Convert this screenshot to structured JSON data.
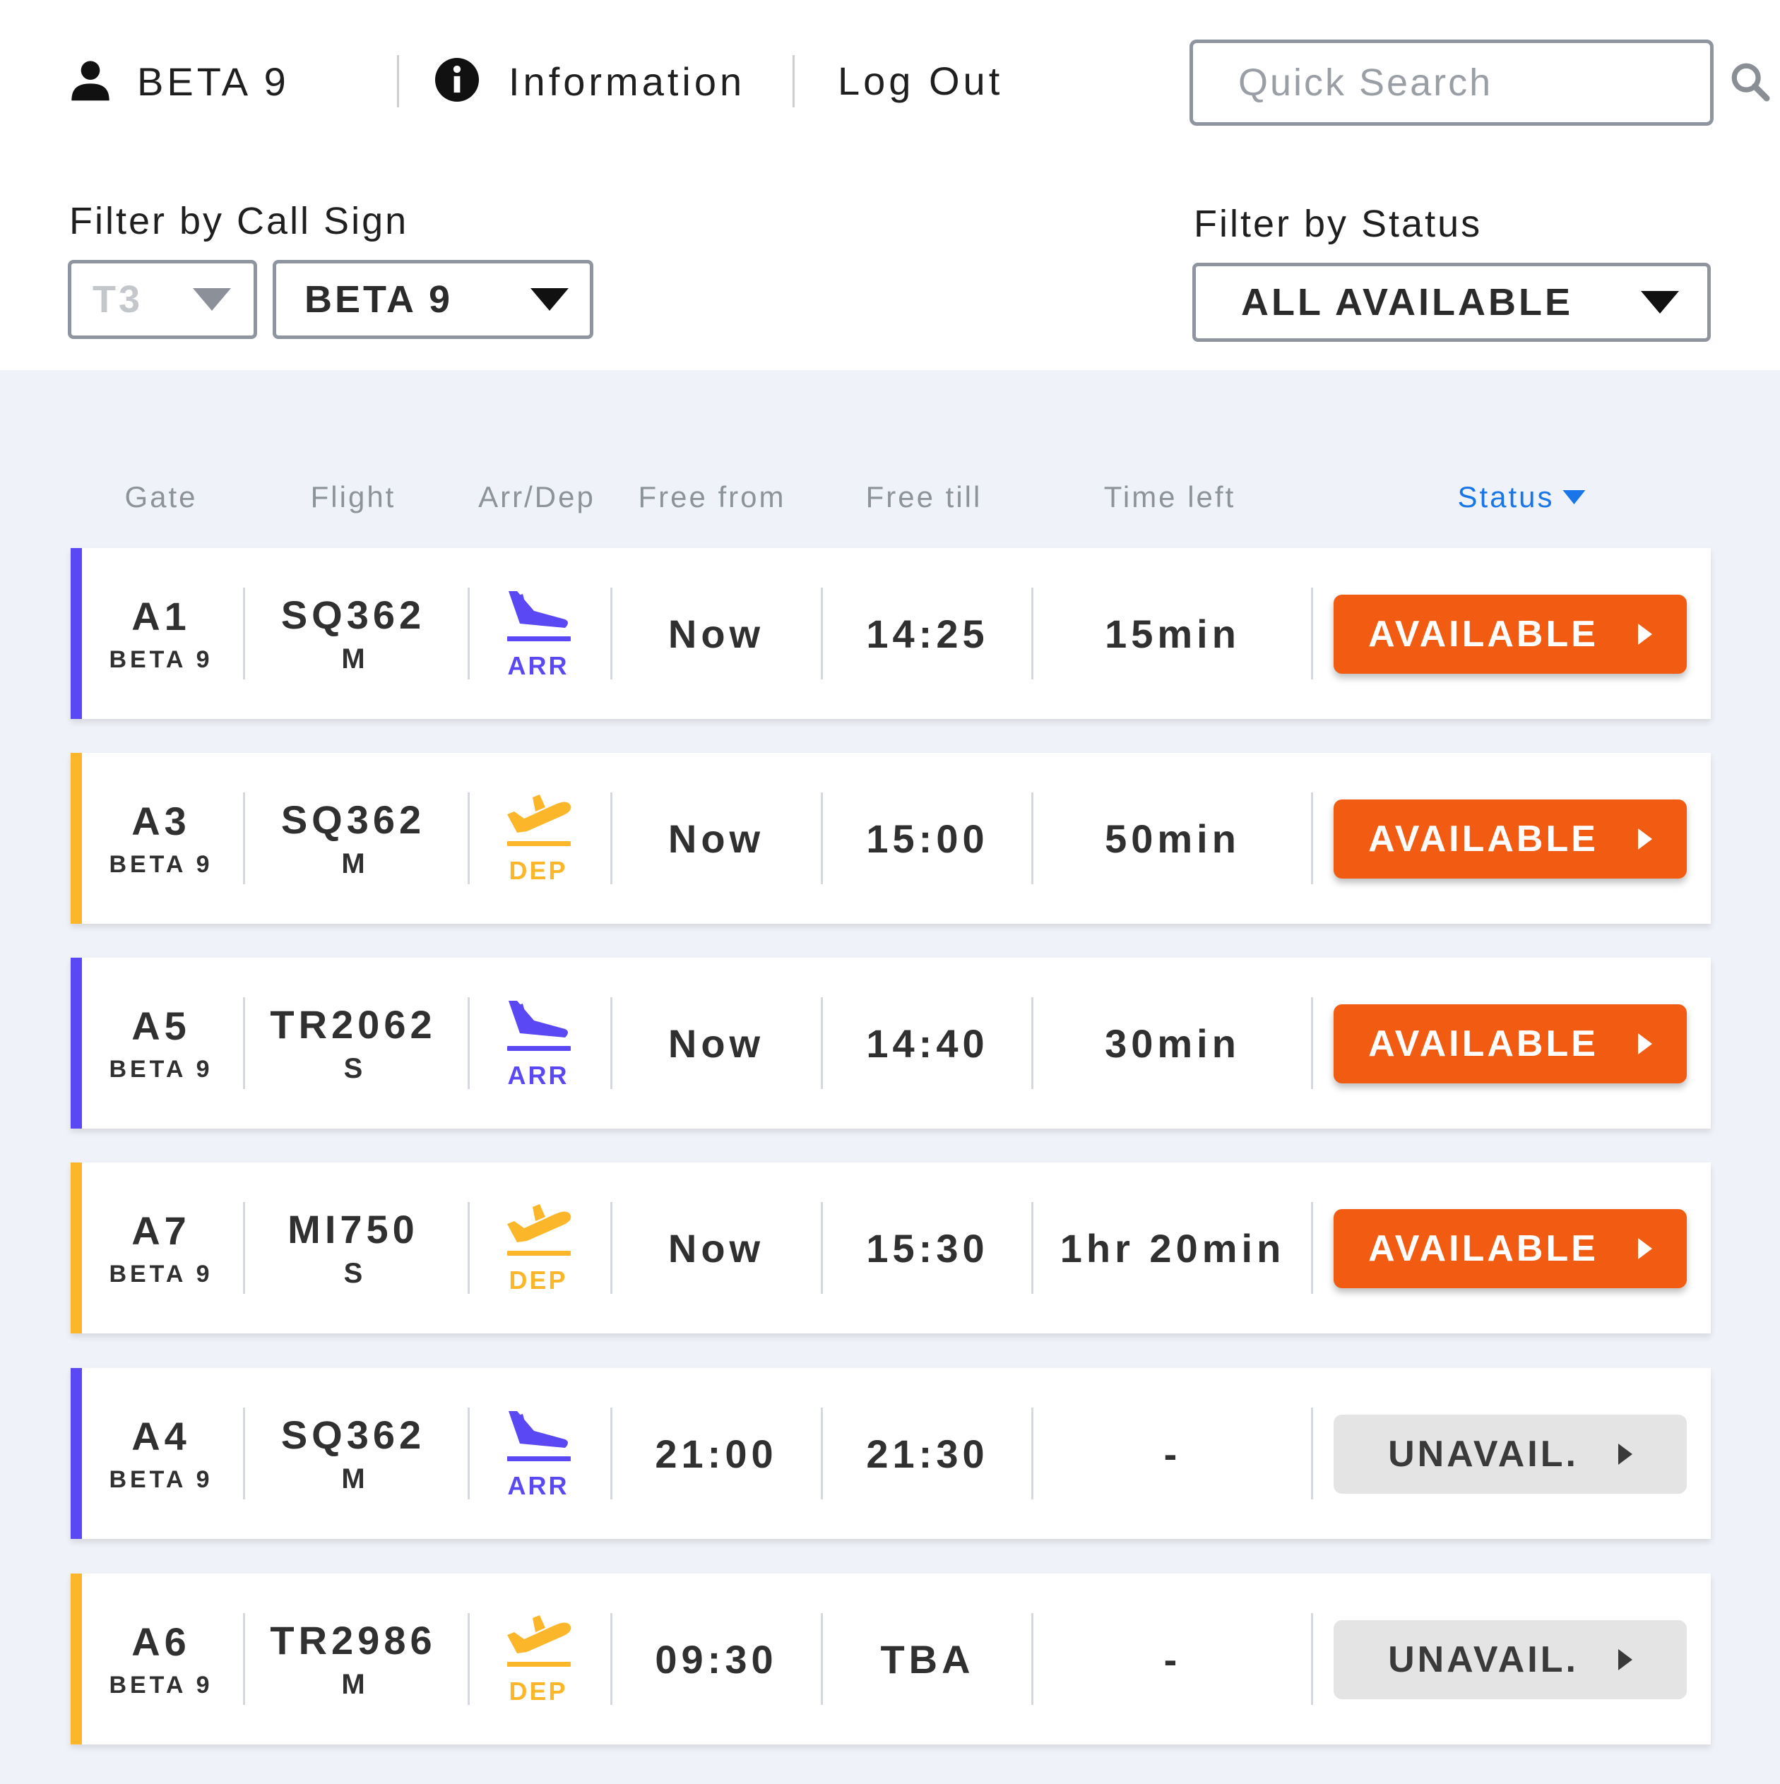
{
  "header": {
    "user_name": "BETA 9",
    "info_label": "Information",
    "logout_label": "Log Out",
    "search_placeholder": "Quick Search"
  },
  "filters": {
    "call_sign_label": "Filter by Call Sign",
    "terminal_value": "T3",
    "call_sign_value": "BETA 9",
    "status_label": "Filter by Status",
    "status_value": "ALL AVAILABLE"
  },
  "columns": {
    "gate": "Gate",
    "flight": "Flight",
    "arrdep": "Arr/Dep",
    "free_from": "Free from",
    "free_till": "Free till",
    "time_left": "Time left",
    "status": "Status"
  },
  "colors": {
    "arrival": "#5a48f5",
    "departure": "#fbb62a",
    "available": "#f15c12",
    "unavailable": "#e4e4e4",
    "sort_active": "#1976e8"
  },
  "rows": [
    {
      "gate": "A1",
      "callsign": "BETA 9",
      "flight": "SQ362",
      "size": "M",
      "type": "ARR",
      "free_from": "Now",
      "free_till": "14:25",
      "time_left": "15min",
      "status": "AVAILABLE"
    },
    {
      "gate": "A3",
      "callsign": "BETA 9",
      "flight": "SQ362",
      "size": "M",
      "type": "DEP",
      "free_from": "Now",
      "free_till": "15:00",
      "time_left": "50min",
      "status": "AVAILABLE"
    },
    {
      "gate": "A5",
      "callsign": "BETA 9",
      "flight": "TR2062",
      "size": "S",
      "type": "ARR",
      "free_from": "Now",
      "free_till": "14:40",
      "time_left": "30min",
      "status": "AVAILABLE"
    },
    {
      "gate": "A7",
      "callsign": "BETA 9",
      "flight": "MI750",
      "size": "S",
      "type": "DEP",
      "free_from": "Now",
      "free_till": "15:30",
      "time_left": "1hr 20min",
      "status": "AVAILABLE"
    },
    {
      "gate": "A4",
      "callsign": "BETA 9",
      "flight": "SQ362",
      "size": "M",
      "type": "ARR",
      "free_from": "21:00",
      "free_till": "21:30",
      "time_left": "-",
      "status": "UNAVAIL."
    },
    {
      "gate": "A6",
      "callsign": "BETA 9",
      "flight": "TR2986",
      "size": "M",
      "type": "DEP",
      "free_from": "09:30",
      "free_till": "TBA",
      "time_left": "-",
      "status": "UNAVAIL."
    }
  ]
}
